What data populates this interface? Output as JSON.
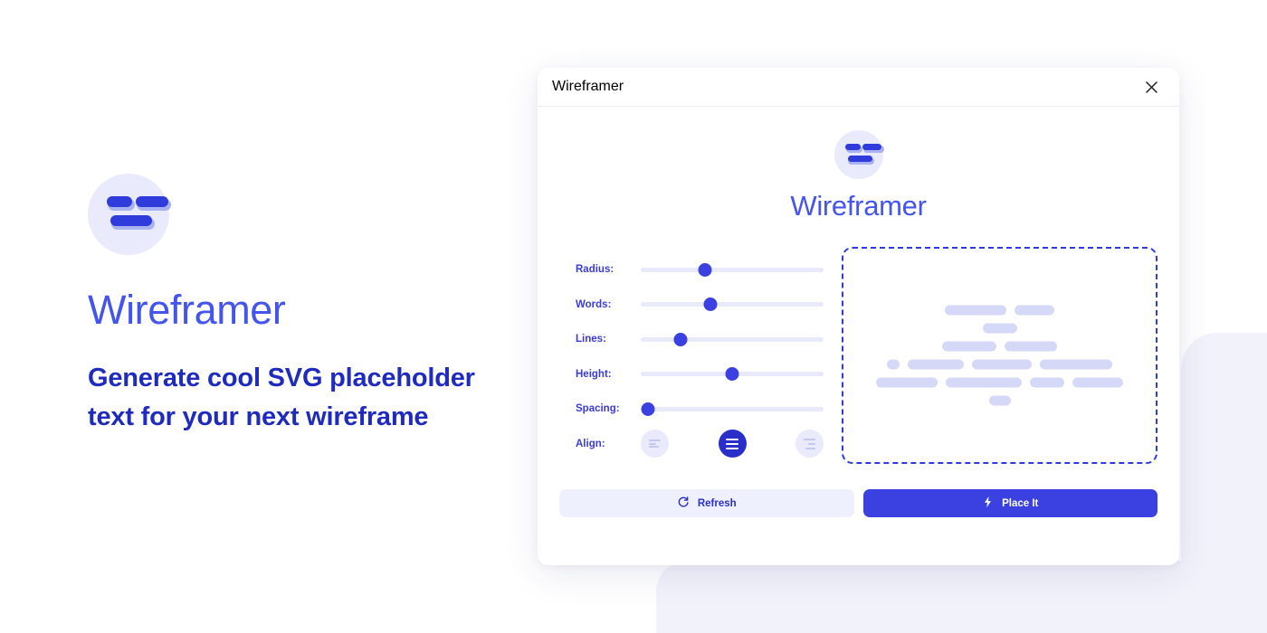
{
  "hero": {
    "logo_icon": "wireframer-logo-icon",
    "title": "Wireframer",
    "subtitle": "Generate cool SVG placeholder text for your next wireframe"
  },
  "panel": {
    "header": {
      "title": "Wireframer",
      "close_icon": "close-icon"
    },
    "brand": {
      "logo_icon": "wireframer-logo-icon",
      "name": "Wireframer"
    },
    "controls": [
      {
        "label": "Radius:",
        "value_pct": 35
      },
      {
        "label": "Words:",
        "value_pct": 38
      },
      {
        "label": "Lines:",
        "value_pct": 22
      },
      {
        "label": "Height:",
        "value_pct": 50
      },
      {
        "label": "Spacing:",
        "value_pct": 4
      }
    ],
    "align": {
      "label": "Align:",
      "options": [
        {
          "name": "align-left-icon",
          "selected": false
        },
        {
          "name": "align-center-icon",
          "selected": true
        },
        {
          "name": "align-right-icon",
          "selected": false
        }
      ]
    },
    "preview": {
      "alignment": "center",
      "lines": [
        [
          68,
          44
        ],
        [
          38
        ],
        [
          60,
          58
        ],
        [
          14,
          62,
          66,
          80
        ],
        [
          68,
          84,
          38,
          56
        ],
        [
          24
        ]
      ]
    },
    "footer": {
      "refresh_label": "Refresh",
      "refresh_icon": "refresh-icon",
      "place_label": "Place It",
      "place_icon": "lightning-bolt-icon"
    }
  },
  "colors": {
    "accent": "#3b41e0",
    "accent_dark": "#2a2fc9",
    "brand_text": "#4455ee",
    "heading": "#1f2bbf",
    "track": "#e8eafb",
    "preview_word": "#d5d8f7",
    "logo_bg": "#e9eafc",
    "background": "#ffffff",
    "blob": "#f2f2fb"
  }
}
